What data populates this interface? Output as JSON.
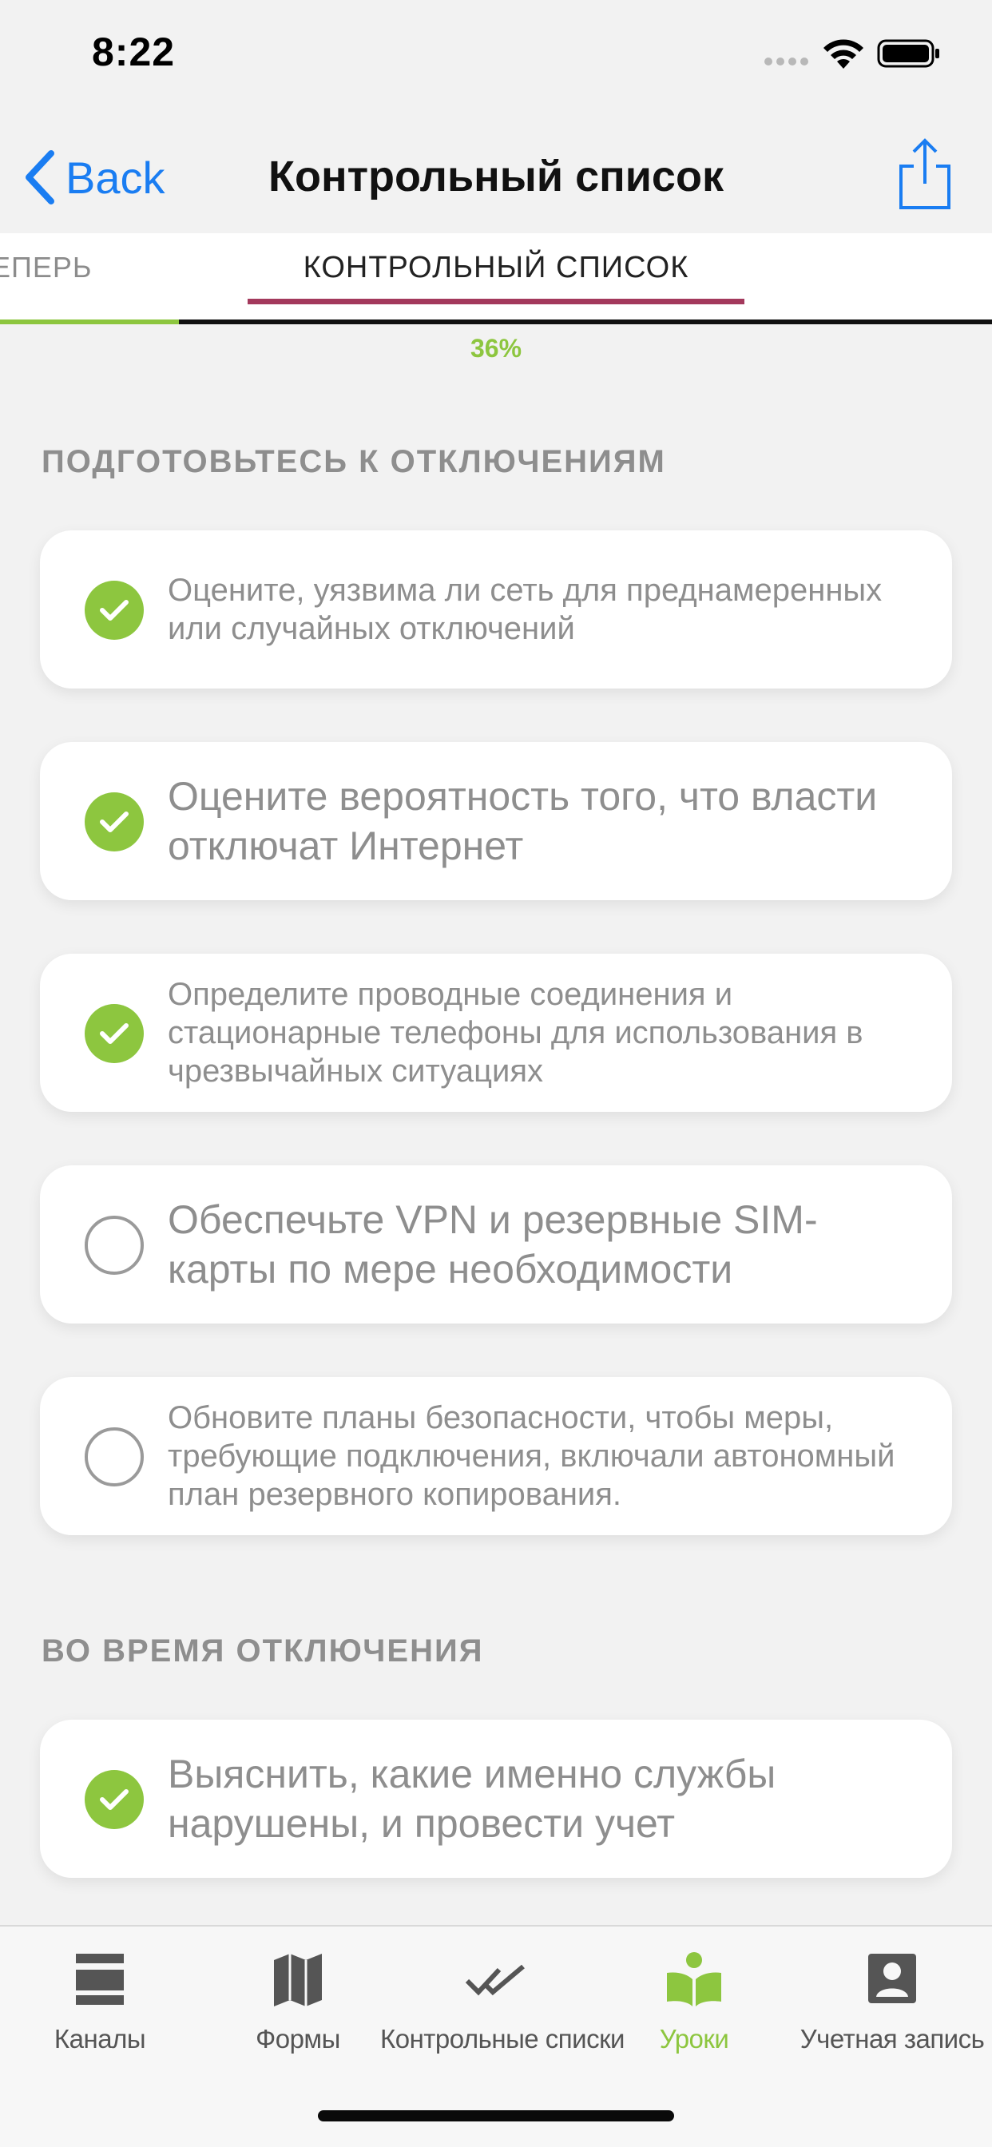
{
  "status_bar": {
    "time": "8:22"
  },
  "nav": {
    "back_label": "Back",
    "title": "Контрольный список"
  },
  "tabs": {
    "previous": "ТЕПЕРЬ",
    "active": "КОНТРОЛЬНЫЙ СПИСОК"
  },
  "progress": {
    "percent_label": "36%",
    "value": 0.36
  },
  "sections": [
    {
      "title": "ПОДГОТОВЬТЕСЬ К ОТКЛЮЧЕНИЯМ",
      "items": [
        {
          "text": "Оцените, уязвима ли сеть для преднамеренных или случайных отключений",
          "checked": true
        },
        {
          "text": "Оцените вероятность того, что власти отключат Интернет",
          "checked": true
        },
        {
          "text": "Определите проводные соединения и стационарные телефоны для использования в чрезвычайных ситуациях",
          "checked": true
        },
        {
          "text": "Обеспечьте VPN и резервные SIM-карты по мере необходимости",
          "checked": false
        },
        {
          "text": "Обновите планы безопасности, чтобы меры, требующие подключения, включали автономный план резервного копирования.",
          "checked": false
        }
      ]
    },
    {
      "title": "ВО ВРЕМЯ ОТКЛЮЧЕНИЯ",
      "items": [
        {
          "text": "Выяснить, какие именно службы нарушены, и провести учет",
          "checked": true
        }
      ]
    }
  ],
  "tab_bar": {
    "items": [
      {
        "label": "Каналы",
        "icon": "feeds-icon"
      },
      {
        "label": "Формы",
        "icon": "map-icon"
      },
      {
        "label": "Контрольные списки",
        "icon": "double-check-icon"
      },
      {
        "label": "Уроки",
        "icon": "lesson-book-icon",
        "active": true
      },
      {
        "label": "Учетная запись",
        "icon": "account-icon"
      }
    ]
  },
  "colors": {
    "accent_green": "#8dc63f",
    "tab_underline": "#a3395c",
    "ios_blue": "#1a7df2"
  }
}
